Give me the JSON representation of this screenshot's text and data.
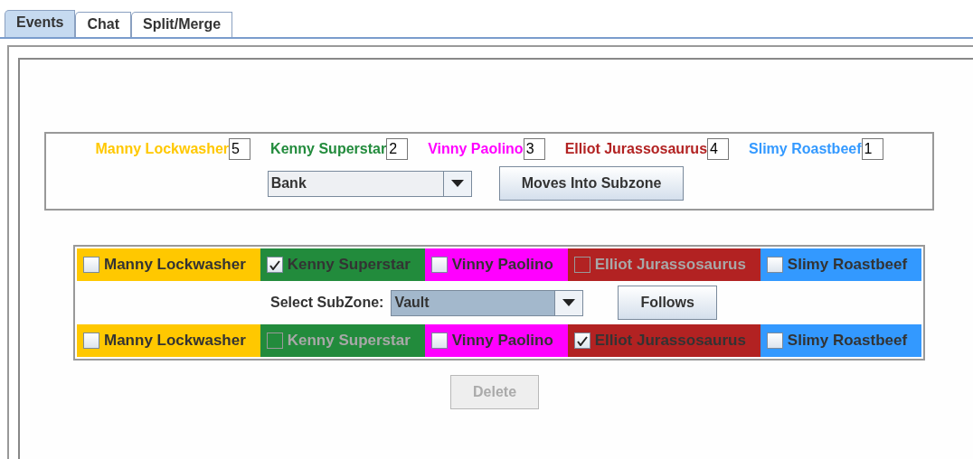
{
  "tabs": [
    {
      "label": "Events",
      "selected": true
    },
    {
      "label": "Chat",
      "selected": false
    },
    {
      "label": "Split/Merge",
      "selected": false
    }
  ],
  "players": [
    {
      "name": "Manny Lockwasher",
      "color": "#ffc800",
      "count": "5"
    },
    {
      "name": "Kenny Superstar",
      "color": "#228b3c",
      "count": "2"
    },
    {
      "name": "Vinny Paolino",
      "color": "#ff00ff",
      "count": "3"
    },
    {
      "name": "Elliot Jurassosaurus",
      "color": "#b22222",
      "count": "4"
    },
    {
      "name": "Slimy Roastbeef",
      "color": "#3399ff",
      "count": "1"
    }
  ],
  "zone_select": {
    "value": "Bank"
  },
  "moves_button": "Moves Into Subzone",
  "leaders": [
    {
      "label": "Manny Lockwasher",
      "color": "#ffc800",
      "checked": false,
      "disabled": false
    },
    {
      "label": "Kenny Superstar",
      "color": "#228b3c",
      "checked": true,
      "disabled": false
    },
    {
      "label": "Vinny Paolino",
      "color": "#ff00ff",
      "checked": false,
      "disabled": false
    },
    {
      "label": "Elliot Jurassosaurus",
      "color": "#b22222",
      "checked": false,
      "disabled": true
    },
    {
      "label": "Slimy Roastbeef",
      "color": "#3399ff",
      "checked": false,
      "disabled": false
    }
  ],
  "subzone_label": "Select SubZone:",
  "subzone_select": {
    "value": "Vault"
  },
  "follows_button": "Follows",
  "followers": [
    {
      "label": "Manny Lockwasher",
      "color": "#ffc800",
      "checked": false,
      "disabled": false
    },
    {
      "label": "Kenny Superstar",
      "color": "#228b3c",
      "checked": false,
      "disabled": true
    },
    {
      "label": "Vinny Paolino",
      "color": "#ff00ff",
      "checked": false,
      "disabled": false
    },
    {
      "label": "Elliot Jurassosaurus",
      "color": "#b22222",
      "checked": true,
      "disabled": false
    },
    {
      "label": "Slimy Roastbeef",
      "color": "#3399ff",
      "checked": false,
      "disabled": false
    }
  ],
  "delete_button": {
    "label": "Delete",
    "disabled": true
  }
}
